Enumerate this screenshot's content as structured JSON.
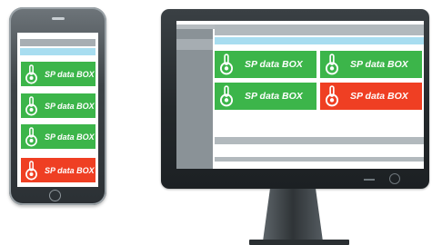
{
  "colors": {
    "tile_ok": "#3cb54a",
    "tile_alert": "#ef3f23",
    "header_blue": "#a8ddf0",
    "bar_gray": "#b2b9bd"
  },
  "phone": {
    "tiles": [
      {
        "label": "SP data BOX",
        "status": "ok",
        "icon": "lock-icon"
      },
      {
        "label": "SP data BOX",
        "status": "ok",
        "icon": "lock-icon"
      },
      {
        "label": "SP data BOX",
        "status": "ok",
        "icon": "lock-icon"
      },
      {
        "label": "SP data BOX",
        "status": "alert",
        "icon": "lock-icon"
      }
    ]
  },
  "monitor": {
    "tiles": [
      {
        "label": "SP data BOX",
        "status": "ok",
        "icon": "lock-icon"
      },
      {
        "label": "SP data BOX",
        "status": "ok",
        "icon": "lock-icon"
      },
      {
        "label": "SP data BOX",
        "status": "ok",
        "icon": "lock-icon"
      },
      {
        "label": "SP data BOX",
        "status": "alert",
        "icon": "lock-icon"
      }
    ]
  }
}
